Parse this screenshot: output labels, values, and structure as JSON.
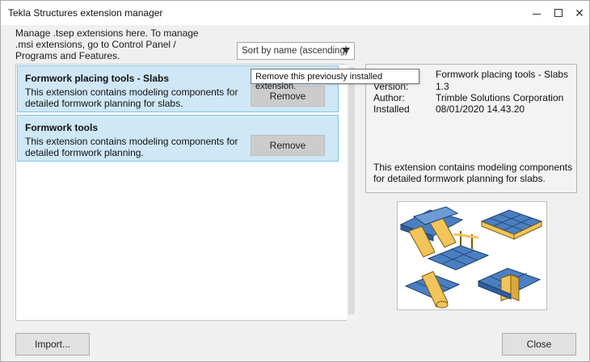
{
  "window": {
    "title": "Tekla Structures extension manager"
  },
  "intro_text": "Manage .tsep extensions here. To manage .msi extensions, go to Control Panel / Programs and Features.",
  "sort": {
    "selected": "Sort by name (ascending)"
  },
  "tooltip": "Remove this previously installed extension.",
  "extensions": [
    {
      "name": "Formwork placing tools - Slabs",
      "description": "This extension contains modeling components for detailed formwork planning for slabs.",
      "remove_label": "Remove"
    },
    {
      "name": "Formwork tools",
      "description": "This extension contains modeling components for detailed formwork planning.",
      "remove_label": "Remove"
    }
  ],
  "details": {
    "version_label": "Version:",
    "author_label": "Author:",
    "installed_label": "Installed",
    "name_value": "Formwork placing tools - Slabs",
    "version_value": "1.3",
    "author_value": "Trimble Solutions Corporation",
    "installed_value": "08/01/2020 14.43.20",
    "description": "This extension contains modeling components for detailed formwork planning for slabs."
  },
  "buttons": {
    "import_label": "Import...",
    "close_label": "Close"
  },
  "colors": {
    "item_bg": "#cfe7f7",
    "item_border": "#82c4ea",
    "slab_blue": "#4a7fc1",
    "timber_yellow": "#f2c45a"
  }
}
